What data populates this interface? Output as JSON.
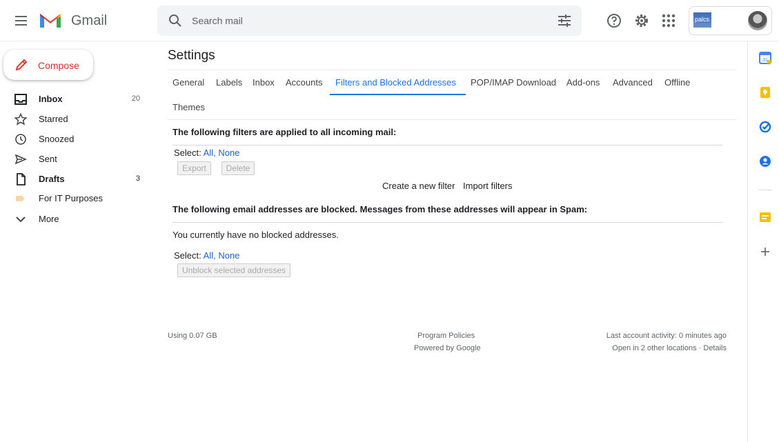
{
  "header": {
    "app_name": "Gmail",
    "search_placeholder": "Search mail",
    "org_logo_text": "palcs"
  },
  "sidebar": {
    "compose_label": "Compose",
    "items": [
      {
        "label": "Inbox",
        "count": "20",
        "icon": "inbox-icon"
      },
      {
        "label": "Starred",
        "count": "",
        "icon": "star-icon"
      },
      {
        "label": "Snoozed",
        "count": "",
        "icon": "clock-icon"
      },
      {
        "label": "Sent",
        "count": "",
        "icon": "send-icon"
      },
      {
        "label": "Drafts",
        "count": "3",
        "icon": "draft-icon"
      },
      {
        "label": "For IT Purposes",
        "count": "",
        "icon": "label-icon"
      },
      {
        "label": "More",
        "count": "",
        "icon": "chevron-down-icon"
      }
    ]
  },
  "settings": {
    "title": "Settings",
    "tabs": [
      "General",
      "Labels",
      "Inbox",
      "Accounts",
      "Filters and Blocked Addresses",
      "POP/IMAP Download",
      "Add-ons",
      "Advanced",
      "Offline",
      "Themes"
    ],
    "active_tab": "Filters and Blocked Addresses",
    "filters_heading": "The following filters are applied to all incoming mail:",
    "select_label": "Select: ",
    "select_all": "All",
    "select_sep": ", ",
    "select_none": "None",
    "export_label": "Export",
    "delete_label": "Delete",
    "create_filter": "Create a new filter",
    "import_filters": "Import filters",
    "blocked_heading": "The following email addresses are blocked. Messages from these addresses will appear in Spam:",
    "no_blocked": "You currently have no blocked addresses.",
    "unblock_label": "Unblock selected addresses"
  },
  "footer": {
    "storage": "Using 0.07 GB",
    "program_policies": "Program Policies",
    "powered_by": "Powered by Google",
    "last_activity": "Last account activity: 0 minutes ago",
    "open_in_other": "Open in 2 other locations · ",
    "details": "Details"
  },
  "colors": {
    "accent": "#1a73e8",
    "compose_text": "#d93025",
    "link": "#1a5fd0"
  }
}
